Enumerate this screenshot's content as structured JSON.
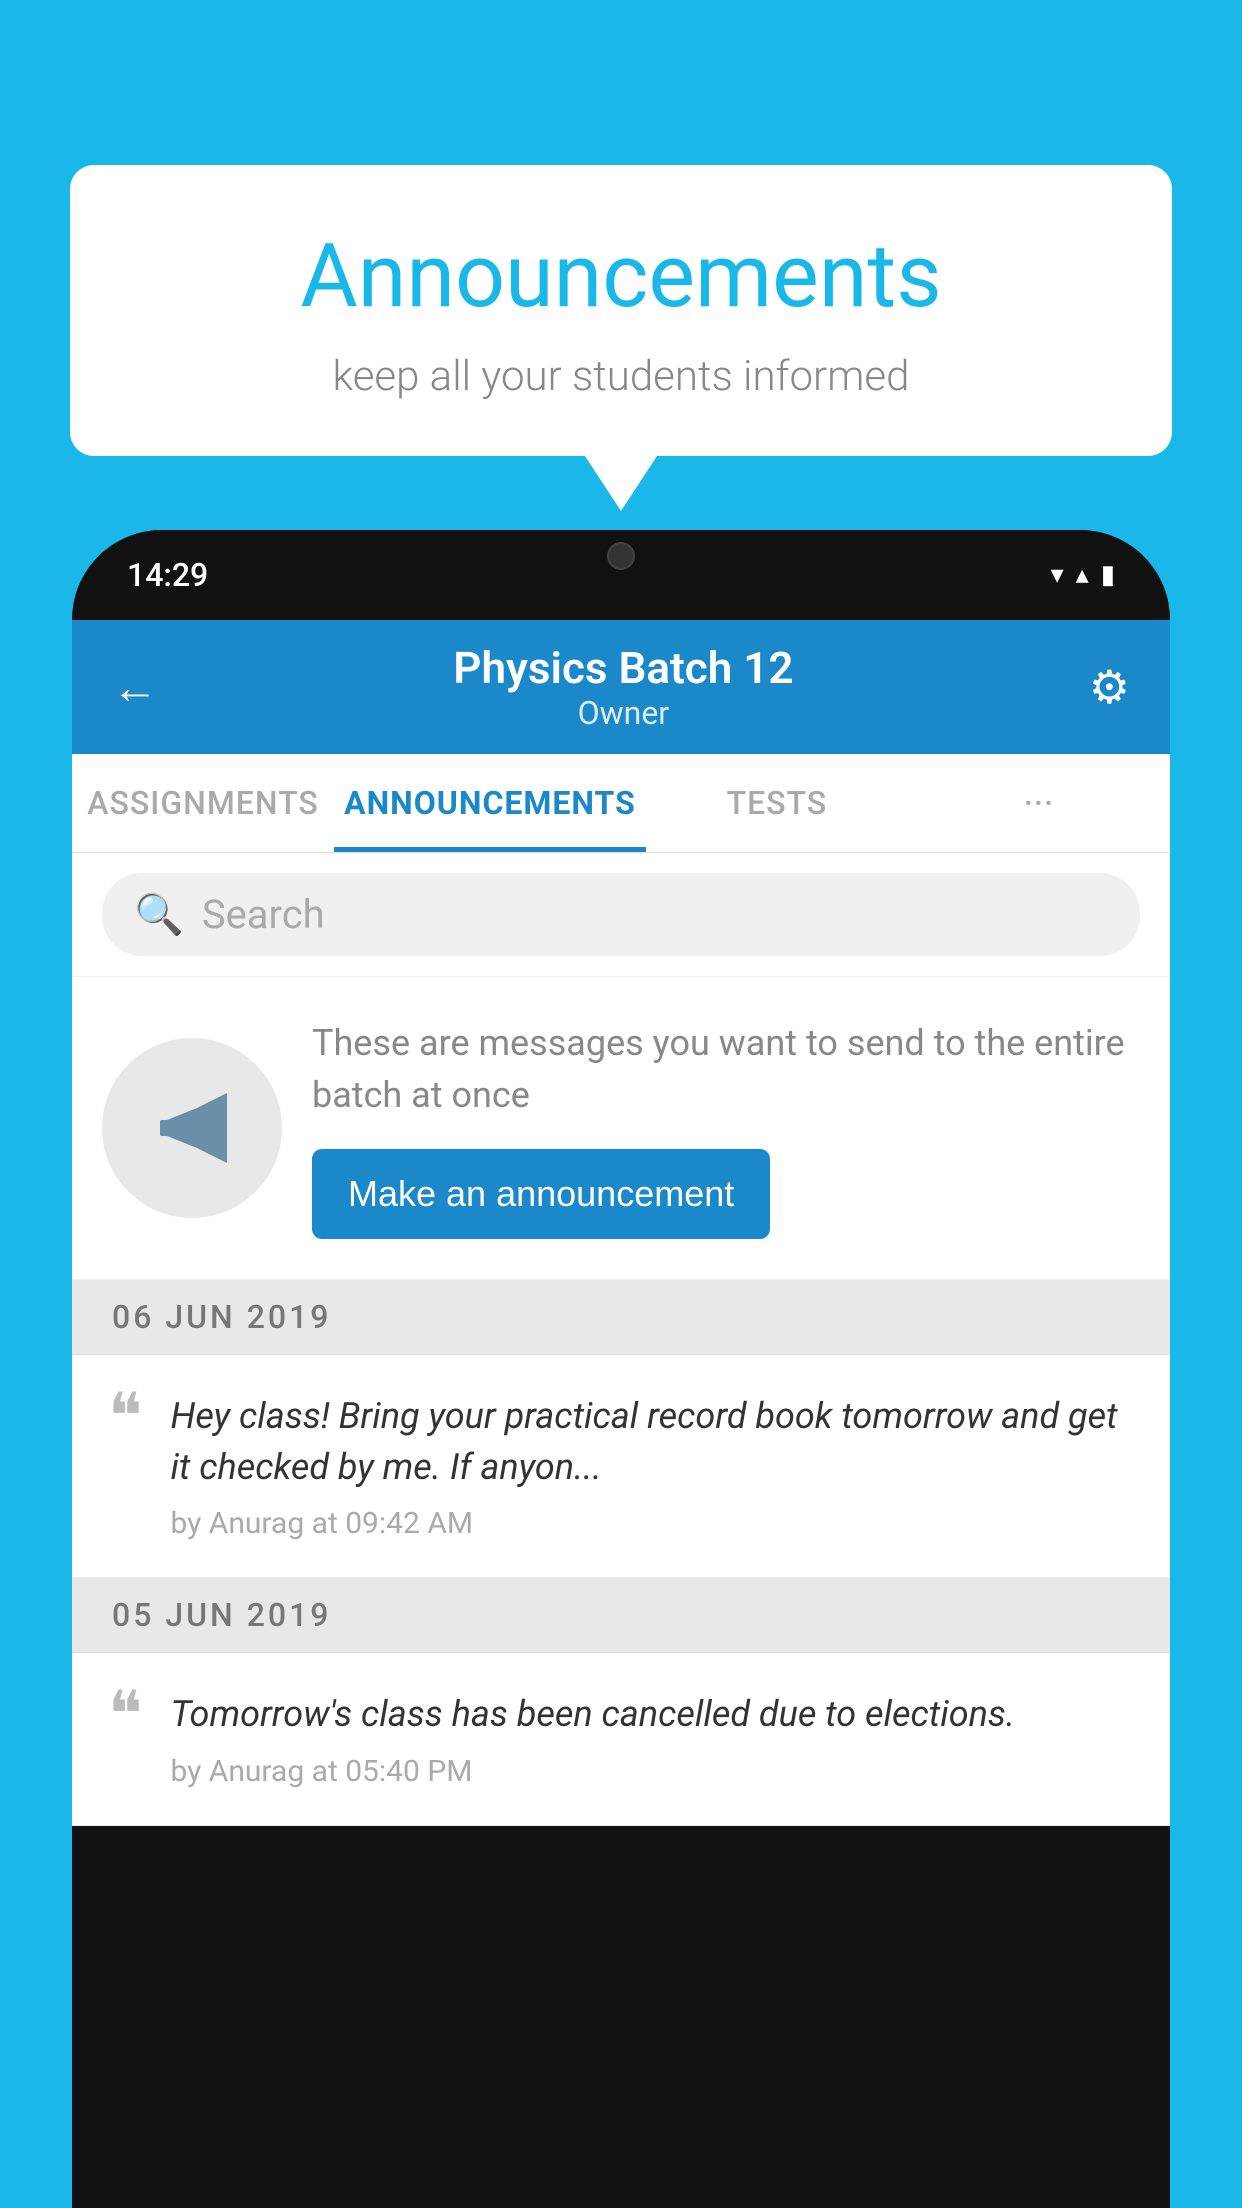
{
  "background_color": "#1ab8e8",
  "speech_bubble": {
    "title": "Announcements",
    "subtitle": "keep all your students informed"
  },
  "status_bar": {
    "time": "14:29",
    "wifi_icon": "▼",
    "signal_icon": "▲",
    "battery_icon": "▮"
  },
  "app_header": {
    "back_label": "←",
    "title": "Physics Batch 12",
    "subtitle": "Owner",
    "gear_label": "⚙"
  },
  "tabs": [
    {
      "label": "ASSIGNMENTS",
      "active": false
    },
    {
      "label": "ANNOUNCEMENTS",
      "active": true
    },
    {
      "label": "TESTS",
      "active": false
    },
    {
      "label": "···",
      "active": false
    }
  ],
  "search": {
    "placeholder": "Search"
  },
  "promo_card": {
    "description": "These are messages you want to send to the entire batch at once",
    "button_label": "Make an announcement"
  },
  "announcements": [
    {
      "date": "06  JUN  2019",
      "text": "Hey class! Bring your practical record book tomorrow and get it checked by me. If anyon...",
      "by": "by Anurag at 09:42 AM"
    },
    {
      "date": "05  JUN  2019",
      "text": "Tomorrow's class has been cancelled due to elections.",
      "by": "by Anurag at 05:40 PM"
    }
  ]
}
